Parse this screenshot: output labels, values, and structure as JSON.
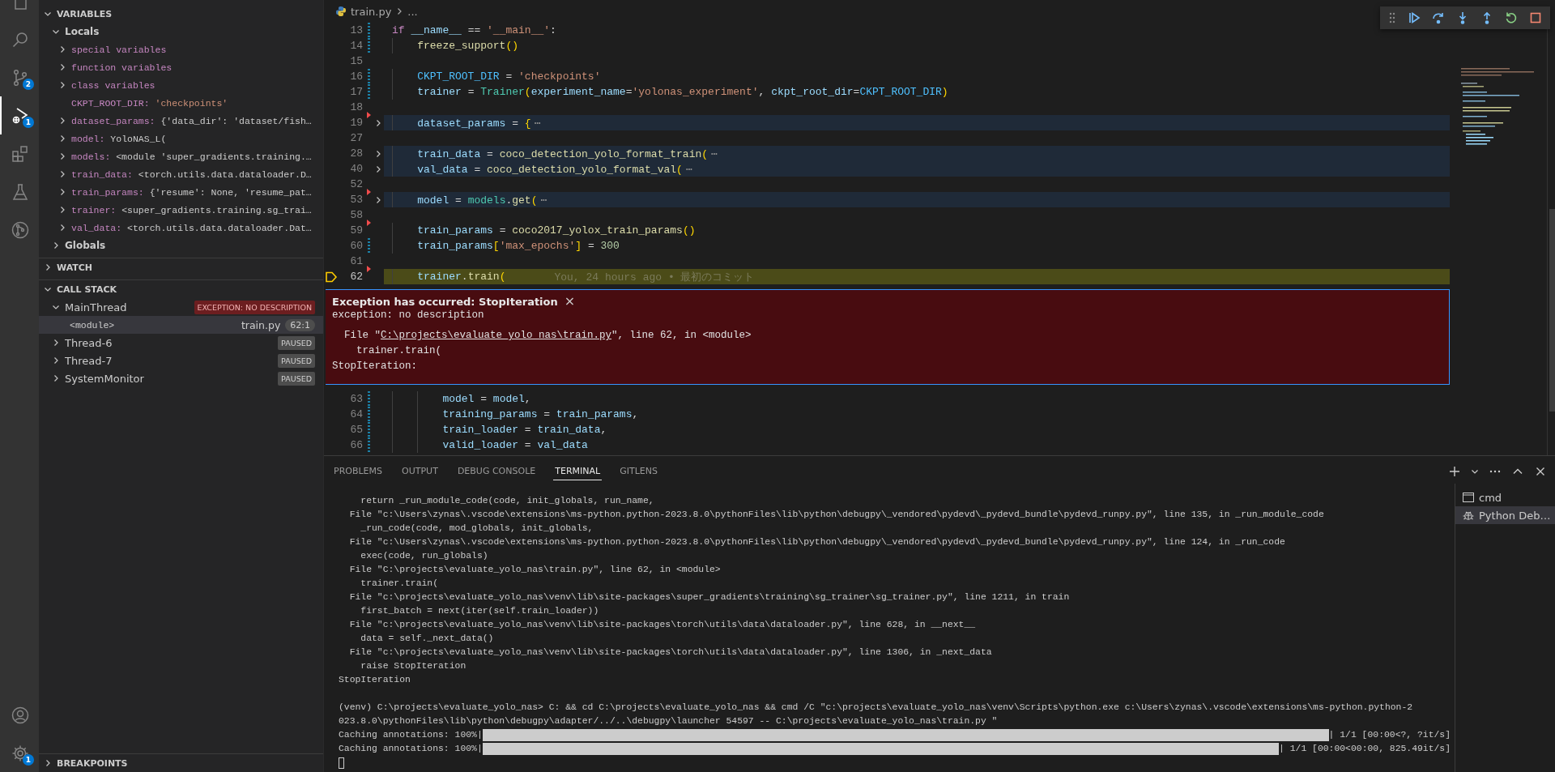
{
  "activity_bar": {
    "top": [
      {
        "kind": "explorer",
        "selected": false
      },
      {
        "kind": "search",
        "selected": false
      },
      {
        "kind": "scm",
        "selected": false,
        "badge": "2"
      },
      {
        "kind": "debug",
        "selected": true,
        "badge": "1"
      },
      {
        "kind": "extensions",
        "selected": false
      },
      {
        "kind": "testing",
        "selected": false
      },
      {
        "kind": "remote",
        "selected": false
      }
    ],
    "bottom": [
      {
        "kind": "accounts",
        "selected": false
      },
      {
        "kind": "manage",
        "selected": false,
        "badge": "1"
      }
    ]
  },
  "sidebar": {
    "variables": {
      "title": "VARIABLES",
      "expanded": true,
      "scopes": [
        {
          "label": "Locals",
          "expanded": true,
          "children": [
            {
              "name": "special variables",
              "expandable": true
            },
            {
              "name": "function variables",
              "expandable": true
            },
            {
              "name": "class variables",
              "expandable": true
            },
            {
              "name": "CKPT_ROOT_DIR:",
              "value": "'checkpoints'",
              "kind": "string",
              "expandable": false
            },
            {
              "name": "dataset_params:",
              "value": "{'data_dir': 'dataset/fish…",
              "kind": "object",
              "expandable": true
            },
            {
              "name": "model:",
              "value": "YoloNAS_L(",
              "kind": "object",
              "expandable": true
            },
            {
              "name": "models:",
              "value": "<module 'super_gradients.training.…",
              "kind": "object",
              "expandable": true
            },
            {
              "name": "train_data:",
              "value": "<torch.utils.data.dataloader.D…",
              "kind": "object",
              "expandable": true
            },
            {
              "name": "train_params:",
              "value": "{'resume': None, 'resume_pat…",
              "kind": "object",
              "expandable": true
            },
            {
              "name": "trainer:",
              "value": "<super_gradients.training.sg_trai…",
              "kind": "object",
              "expandable": true
            },
            {
              "name": "val_data:",
              "value": "<torch.utils.data.dataloader.Dat…",
              "kind": "object",
              "expandable": true
            }
          ]
        },
        {
          "label": "Globals",
          "expanded": false
        }
      ]
    },
    "watch": {
      "title": "WATCH",
      "expanded": false
    },
    "call_stack": {
      "title": "CALL STACK",
      "expanded": true,
      "threads": [
        {
          "name": "MainThread",
          "expanded": true,
          "status": "EXCEPTION: NO DESCRIPTION",
          "kind": "exception",
          "frames": [
            {
              "name": "<module>",
              "file": "train.py",
              "position": "62:1",
              "selected": true
            }
          ]
        },
        {
          "name": "Thread-6",
          "expanded": false,
          "status": "PAUSED",
          "kind": "paused"
        },
        {
          "name": "Thread-7",
          "expanded": false,
          "status": "PAUSED",
          "kind": "paused"
        },
        {
          "name": "SystemMonitor",
          "expanded": false,
          "status": "PAUSED",
          "kind": "paused"
        }
      ]
    },
    "breakpoints": {
      "title": "BREAKPOINTS",
      "expanded": false
    }
  },
  "editor": {
    "breadcrumb": {
      "file": "train.py",
      "rest": "..."
    },
    "lines": [
      {
        "number": "13",
        "modified": true,
        "tokens": [
          {
            "kind": "kw",
            "text": "if"
          },
          {
            "kind": "var",
            "text": " __name__"
          },
          {
            "kind": "p",
            "text": " == "
          },
          {
            "kind": "str",
            "text": "'__main__'"
          },
          {
            "kind": "p",
            "text": ":"
          }
        ]
      },
      {
        "number": "14",
        "modified": true,
        "tokens": [
          {
            "kind": "fn",
            "text": "    freeze_support"
          },
          {
            "kind": "br",
            "text": "()"
          }
        ]
      },
      {
        "number": "15"
      },
      {
        "number": "16",
        "modified": true,
        "tokens": [
          {
            "kind": "const",
            "text": "    CKPT_ROOT_DIR"
          },
          {
            "kind": "p",
            "text": " = "
          },
          {
            "kind": "str",
            "text": "'checkpoints'"
          }
        ]
      },
      {
        "number": "17",
        "modified": true,
        "tokens": [
          {
            "kind": "var",
            "text": "    trainer"
          },
          {
            "kind": "p",
            "text": " = "
          },
          {
            "kind": "cls",
            "text": "Trainer"
          },
          {
            "kind": "br",
            "text": "("
          },
          {
            "kind": "var",
            "text": "experiment_name"
          },
          {
            "kind": "p",
            "text": "="
          },
          {
            "kind": "str",
            "text": "'yolonas_experiment'"
          },
          {
            "kind": "p",
            "text": ", "
          },
          {
            "kind": "var",
            "text": "ckpt_root_dir"
          },
          {
            "kind": "p",
            "text": "="
          },
          {
            "kind": "const",
            "text": "CKPT_ROOT_DIR"
          },
          {
            "kind": "br",
            "text": ")"
          }
        ]
      },
      {
        "number": "18"
      },
      {
        "number": "19",
        "deleted": true,
        "folded": true,
        "tokens": [
          {
            "kind": "var",
            "text": "    dataset_params"
          },
          {
            "kind": "p",
            "text": " = "
          },
          {
            "kind": "br",
            "text": "{"
          },
          {
            "kind": "fold",
            "text": "⋯"
          }
        ]
      },
      {
        "number": "27"
      },
      {
        "number": "28",
        "folded": true,
        "tokens": [
          {
            "kind": "var",
            "text": "    train_data"
          },
          {
            "kind": "p",
            "text": " = "
          },
          {
            "kind": "fn",
            "text": "coco_detection_yolo_format_train"
          },
          {
            "kind": "br",
            "text": "("
          },
          {
            "kind": "fold",
            "text": "⋯"
          }
        ]
      },
      {
        "number": "40",
        "folded": true,
        "tokens": [
          {
            "kind": "var",
            "text": "    val_data"
          },
          {
            "kind": "p",
            "text": " = "
          },
          {
            "kind": "fn",
            "text": "coco_detection_yolo_format_val"
          },
          {
            "kind": "br",
            "text": "("
          },
          {
            "kind": "fold",
            "text": "⋯"
          }
        ]
      },
      {
        "number": "52"
      },
      {
        "number": "53",
        "deleted": true,
        "folded": true,
        "tokens": [
          {
            "kind": "var",
            "text": "    model"
          },
          {
            "kind": "p",
            "text": " = "
          },
          {
            "kind": "cls",
            "text": "models"
          },
          {
            "kind": "p",
            "text": "."
          },
          {
            "kind": "fn",
            "text": "get"
          },
          {
            "kind": "br",
            "text": "("
          },
          {
            "kind": "fold",
            "text": "⋯"
          }
        ]
      },
      {
        "number": "58"
      },
      {
        "number": "59",
        "deleted": true,
        "tokens": [
          {
            "kind": "var",
            "text": "    train_params"
          },
          {
            "kind": "p",
            "text": " = "
          },
          {
            "kind": "fn",
            "text": "coco2017_yolox_train_params"
          },
          {
            "kind": "br",
            "text": "()"
          }
        ]
      },
      {
        "number": "60",
        "modified": true,
        "tokens": [
          {
            "kind": "var",
            "text": "    train_params"
          },
          {
            "kind": "br",
            "text": "["
          },
          {
            "kind": "str",
            "text": "'max_epochs'"
          },
          {
            "kind": "br",
            "text": "]"
          },
          {
            "kind": "p",
            "text": " = "
          },
          {
            "kind": "num",
            "text": "300"
          }
        ]
      },
      {
        "number": "61"
      },
      {
        "number": "62",
        "deleted": true,
        "current": true,
        "tokens": [
          {
            "kind": "var",
            "text": "    trainer"
          },
          {
            "kind": "p",
            "text": "."
          },
          {
            "kind": "fn",
            "text": "train"
          },
          {
            "kind": "br",
            "text": "("
          }
        ],
        "blame": "You, 24 hours ago • 最初のコミット"
      }
    ],
    "exception": {
      "title": "Exception has occurred: StopIteration",
      "close": "×",
      "description": "exception: no description",
      "trace": [
        {
          "prefix": "  File \"",
          "link": "C:\\projects\\evaluate_yolo_nas\\train.py",
          "suffix": "\", line 62, in <module>"
        },
        {
          "prefix": "    trainer.train("
        },
        {
          "prefix": "StopIteration:"
        }
      ]
    },
    "lines_after": [
      {
        "number": "63",
        "modified": true,
        "tokens": [
          {
            "kind": "var",
            "text": "        model"
          },
          {
            "kind": "p",
            "text": " = "
          },
          {
            "kind": "var",
            "text": "model"
          },
          {
            "kind": "p",
            "text": ","
          }
        ]
      },
      {
        "number": "64",
        "modified": true,
        "tokens": [
          {
            "kind": "var",
            "text": "        training_params"
          },
          {
            "kind": "p",
            "text": " = "
          },
          {
            "kind": "var",
            "text": "train_params"
          },
          {
            "kind": "p",
            "text": ","
          }
        ]
      },
      {
        "number": "65",
        "modified": true,
        "tokens": [
          {
            "kind": "var",
            "text": "        train_loader"
          },
          {
            "kind": "p",
            "text": " = "
          },
          {
            "kind": "var",
            "text": "train_data"
          },
          {
            "kind": "p",
            "text": ","
          }
        ]
      },
      {
        "number": "66",
        "modified": true,
        "tokens": [
          {
            "kind": "var",
            "text": "        valid_loader"
          },
          {
            "kind": "p",
            "text": " = "
          },
          {
            "kind": "var",
            "text": "val_data"
          }
        ]
      }
    ]
  },
  "panel": {
    "tabs": [
      {
        "label": "PROBLEMS",
        "selected": false
      },
      {
        "label": "OUTPUT",
        "selected": false
      },
      {
        "label": "DEBUG CONSOLE",
        "selected": false
      },
      {
        "label": "TERMINAL",
        "selected": true
      },
      {
        "label": "GITLENS",
        "selected": false
      }
    ],
    "terminal": [
      {
        "kind": "text",
        "text": "    return _run_module_code(code, init_globals, run_name,"
      },
      {
        "kind": "text",
        "text": "  File \"c:\\Users\\zynas\\.vscode\\extensions\\ms-python.python-2023.8.0\\pythonFiles\\lib\\python\\debugpy\\_vendored\\pydevd\\_pydevd_bundle\\pydevd_runpy.py\", line 135, in _run_module_code"
      },
      {
        "kind": "text",
        "text": "    _run_code(code, mod_globals, init_globals,"
      },
      {
        "kind": "text",
        "text": "  File \"c:\\Users\\zynas\\.vscode\\extensions\\ms-python.python-2023.8.0\\pythonFiles\\lib\\python\\debugpy\\_vendored\\pydevd\\_pydevd_bundle\\pydevd_runpy.py\", line 124, in _run_code"
      },
      {
        "kind": "text",
        "text": "    exec(code, run_globals)"
      },
      {
        "kind": "text",
        "text": "  File \"C:\\projects\\evaluate_yolo_nas\\train.py\", line 62, in <module>"
      },
      {
        "kind": "text",
        "text": "    trainer.train("
      },
      {
        "kind": "text",
        "text": "  File \"c:\\projects\\evaluate_yolo_nas\\venv\\lib\\site-packages\\super_gradients\\training\\sg_trainer\\sg_trainer.py\", line 1211, in train"
      },
      {
        "kind": "text",
        "text": "    first_batch = next(iter(self.train_loader))"
      },
      {
        "kind": "text",
        "text": "  File \"c:\\projects\\evaluate_yolo_nas\\venv\\lib\\site-packages\\torch\\utils\\data\\dataloader.py\", line 628, in __next__"
      },
      {
        "kind": "text",
        "text": "    data = self._next_data()"
      },
      {
        "kind": "text",
        "text": "  File \"c:\\projects\\evaluate_yolo_nas\\venv\\lib\\site-packages\\torch\\utils\\data\\dataloader.py\", line 1306, in _next_data"
      },
      {
        "kind": "text",
        "text": "    raise StopIteration"
      },
      {
        "kind": "text",
        "text": "StopIteration"
      },
      {
        "kind": "blank"
      },
      {
        "kind": "text",
        "text": "(venv) C:\\projects\\evaluate_yolo_nas> C: && cd C:\\projects\\evaluate_yolo_nas && cmd /C \"c:\\projects\\evaluate_yolo_nas\\venv\\Scripts\\python.exe c:\\Users\\zynas\\.vscode\\extensions\\ms-python.python-2"
      },
      {
        "kind": "text",
        "text": "023.8.0\\pythonFiles\\lib\\python\\debugpy\\adapter/../..\\debugpy\\launcher 54597 -- C:\\projects\\evaluate_yolo_nas\\train.py \""
      },
      {
        "kind": "progress",
        "prefix": "Caching annotations: 100%|",
        "level": 1,
        "suffix": "| 1/1 [00:00<?, ?it/s]"
      },
      {
        "kind": "progress",
        "prefix": "Caching annotations: 100%|",
        "level": 1,
        "suffix": "| 1/1 [00:00<00:00, 825.49it/s]"
      },
      {
        "kind": "cursor"
      }
    ],
    "terminals": [
      {
        "name": "cmd",
        "kind": "cmd",
        "selected": false
      },
      {
        "name": "Python Deb…",
        "kind": "debug",
        "selected": true
      }
    ]
  }
}
